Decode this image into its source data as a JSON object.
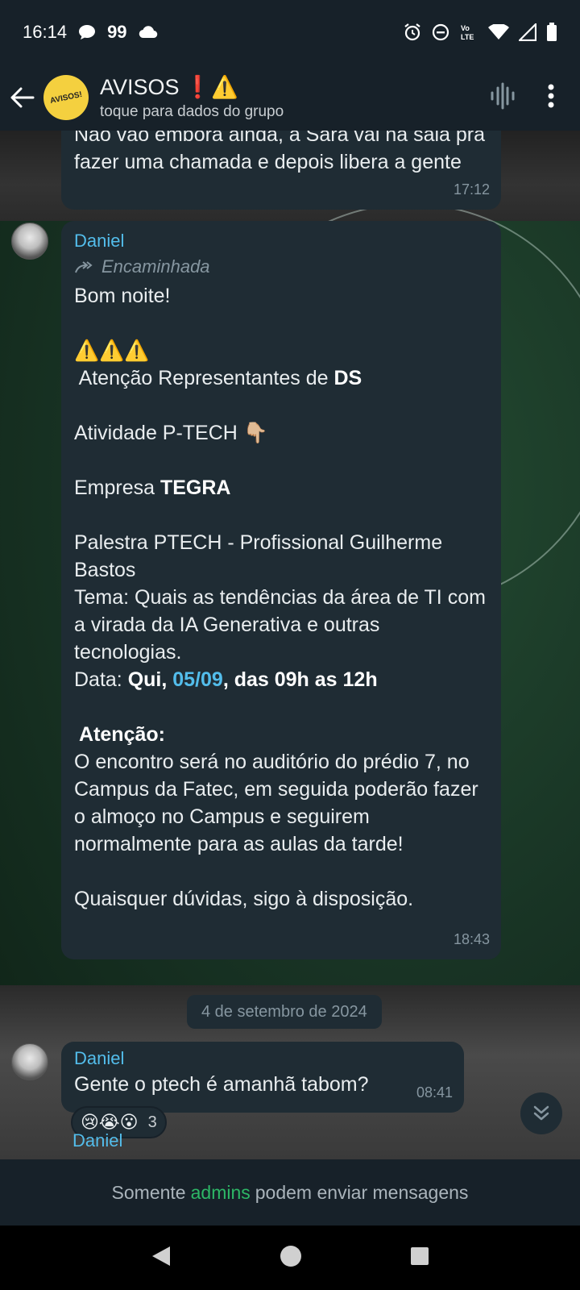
{
  "status_bar": {
    "time": "16:14",
    "notification_count": "99",
    "icons": [
      "chat-bubble-icon",
      "cloud-icon",
      "alarm-icon",
      "dnd-icon",
      "volte-icon",
      "wifi-icon",
      "signal-icon",
      "battery-icon"
    ],
    "volte_label": "Vo LTE"
  },
  "header": {
    "title": "AVISOS",
    "title_emojis": "❗⚠️",
    "subtitle": "toque para dados do grupo",
    "avatar_text": "AVISOS!"
  },
  "messages": [
    {
      "text": "Não vão embora ainda, a Sara vai na sala pra fazer uma chamada e depois libera a gente",
      "time": "17:12"
    },
    {
      "sender": "Daniel",
      "forwarded_label": "Encaminhada",
      "greeting": "Bom noite!",
      "warning_emojis": "⚠️⚠️⚠️",
      "line_attention_pre": " Atenção Representantes de ",
      "line_attention_bold": "DS",
      "activity": "Atividade P-TECH 👇🏼",
      "company_pre": "Empresa ",
      "company_bold": "TEGRA",
      "talk": "Palestra PTECH - Profissional Guilherme Bastos",
      "theme": "Tema: Quais as tendências da área de TI com a virada da IA Generativa e outras tecnologias.",
      "date_label": "Data: ",
      "date_day": "Qui, ",
      "date_link": "05/09",
      "date_rest": ", das 09h as 12h",
      "attention2": " Atenção:",
      "body": "O encontro será no auditório do prédio 7, no Campus da Fatec, em seguida poderão fazer o almoço no Campus e seguirem normalmente para as aulas da tarde!",
      "closing": "Quaisquer dúvidas, sigo à disposição.",
      "time": "18:43"
    },
    {
      "sender": "Daniel",
      "text": "Gente o ptech é amanhã tabom?",
      "time": "08:41",
      "reactions": "😢😭😮",
      "reaction_count": "3"
    }
  ],
  "date_separator": "4 de setembro de 2024",
  "peek_sender": "Daniel",
  "footer": {
    "pre": "Somente",
    "highlight": "admins",
    "post": "podem enviar mensagens"
  },
  "colors": {
    "accent_blue": "#53bdeb",
    "accent_green": "#2db766",
    "bubble": "#1f2c34",
    "header": "#172129"
  }
}
